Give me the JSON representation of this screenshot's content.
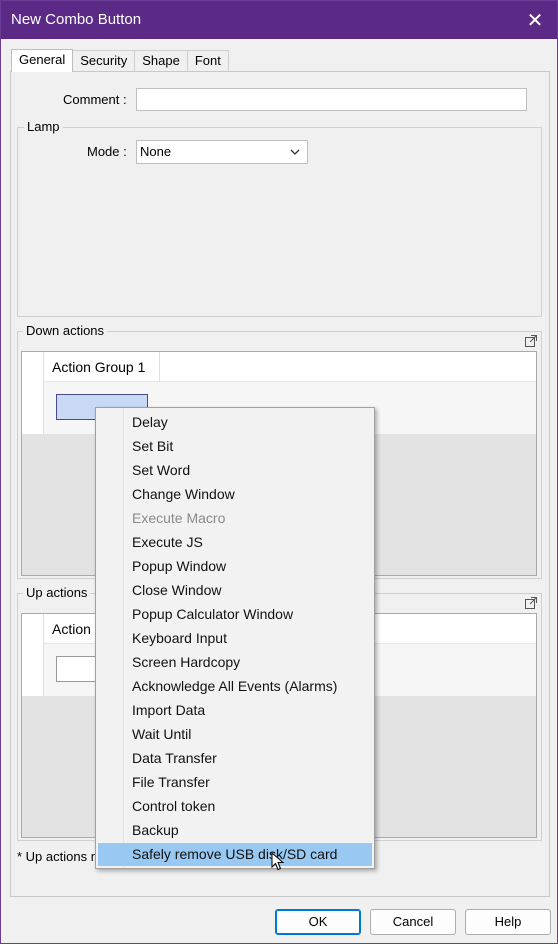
{
  "window": {
    "title": "New Combo Button",
    "close_glyph": "✕"
  },
  "tabs": [
    "General",
    "Security",
    "Shape",
    "Font"
  ],
  "general": {
    "comment_label": "Comment :",
    "comment_value": "",
    "lamp_title": "Lamp",
    "mode_label": "Mode :",
    "mode_value": "None"
  },
  "down_actions": {
    "title": "Down actions",
    "group_label": "Action Group 1"
  },
  "up_actions": {
    "title": "Up actions",
    "group_label": "Action"
  },
  "footnote": "* Up actions n",
  "buttons": {
    "ok": "OK",
    "cancel": "Cancel",
    "help": "Help"
  },
  "context_menu": {
    "items": [
      {
        "label": "Delay",
        "state": "normal"
      },
      {
        "label": "Set Bit",
        "state": "normal"
      },
      {
        "label": "Set Word",
        "state": "normal"
      },
      {
        "label": "Change Window",
        "state": "normal"
      },
      {
        "label": "Execute Macro",
        "state": "disabled"
      },
      {
        "label": "Execute JS",
        "state": "normal"
      },
      {
        "label": "Popup Window",
        "state": "normal"
      },
      {
        "label": "Close Window",
        "state": "normal"
      },
      {
        "label": "Popup Calculator Window",
        "state": "normal"
      },
      {
        "label": "Keyboard Input",
        "state": "normal"
      },
      {
        "label": "Screen Hardcopy",
        "state": "normal"
      },
      {
        "label": "Acknowledge All Events (Alarms)",
        "state": "normal"
      },
      {
        "label": "Import Data",
        "state": "normal"
      },
      {
        "label": "Wait Until",
        "state": "normal"
      },
      {
        "label": "Data Transfer",
        "state": "normal"
      },
      {
        "label": "File Transfer",
        "state": "normal"
      },
      {
        "label": "Control token",
        "state": "normal"
      },
      {
        "label": "Backup",
        "state": "normal"
      },
      {
        "label": "Safely remove USB disk/SD card",
        "state": "hover"
      }
    ]
  },
  "colors": {
    "titlebar": "#5b2a86",
    "menu_hover": "#99c9f2",
    "default_button_border": "#0078d4"
  }
}
